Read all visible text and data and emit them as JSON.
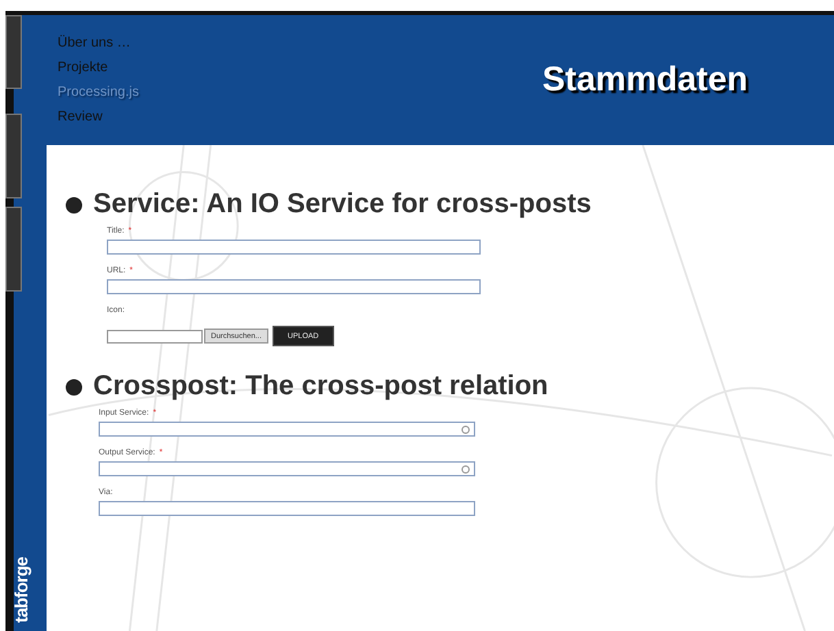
{
  "nav": [
    {
      "label": "Über uns …",
      "selected": false
    },
    {
      "label": "Projekte",
      "selected": false
    },
    {
      "label": "Processing.js",
      "selected": true
    },
    {
      "label": "Review",
      "selected": false
    }
  ],
  "title": "Stammdaten",
  "sections": [
    {
      "heading": "Service: An IO Service for cross-posts",
      "fields": [
        {
          "kind": "text",
          "label": "Title:",
          "required": true
        },
        {
          "kind": "text",
          "label": "URL:",
          "required": true
        },
        {
          "kind": "file",
          "label": "Icon:",
          "required": false,
          "browse": "Durchsuchen...",
          "upload": "UPLOAD"
        }
      ]
    },
    {
      "heading": "Crosspost: The cross-post relation",
      "fields": [
        {
          "kind": "select",
          "label": "Input Service:",
          "required": true
        },
        {
          "kind": "select",
          "label": "Output Service:",
          "required": true
        },
        {
          "kind": "text",
          "label": "Via:",
          "required": false
        }
      ]
    }
  ],
  "required_mark": "*",
  "logo": "tabforge"
}
